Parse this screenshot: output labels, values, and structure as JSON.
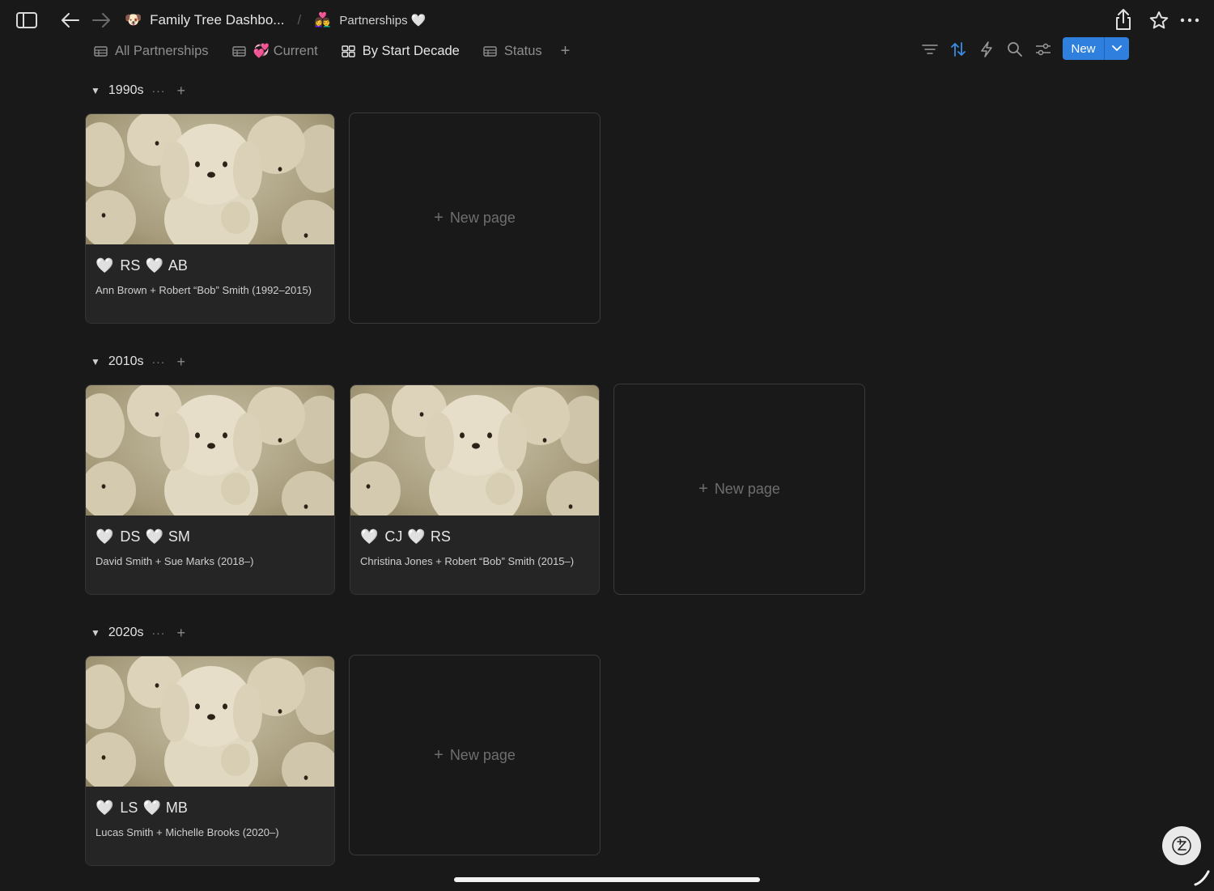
{
  "topbar": {
    "crumb1_emoji": "🐶",
    "crumb1_title": "Family Tree Dashbo...",
    "separator": "/",
    "crumb2_emoji": "👩‍❤️‍👨",
    "crumb2_title": "Partnerships 🤍"
  },
  "tabs": [
    {
      "label": "All Partnerships",
      "icon": "table-icon"
    },
    {
      "label": "💞 Current",
      "icon": "table-icon"
    },
    {
      "label": "By Start Decade",
      "icon": "gallery-icon",
      "active": true
    },
    {
      "label": "Status",
      "icon": "table-icon"
    }
  ],
  "tab_add": "+",
  "toolbar": {
    "new_label": "New",
    "accent": "#2f80de"
  },
  "groups": [
    {
      "name": "1990s",
      "cards": [
        {
          "a": "RS",
          "b": "AB",
          "desc": "Ann Brown + Robert “Bob” Smith (1992–2015)"
        }
      ],
      "new_page": "New page"
    },
    {
      "name": "2010s",
      "cards": [
        {
          "a": "DS",
          "b": "SM",
          "desc": "David Smith + Sue Marks (2018–)"
        },
        {
          "a": "CJ",
          "b": "RS",
          "desc": "Christina Jones + Robert “Bob” Smith (2015–)"
        }
      ],
      "new_page": "New page"
    },
    {
      "name": "2020s",
      "cards": [
        {
          "a": "LS",
          "b": "MB",
          "desc": "Lucas Smith + Michelle Brooks (2020–)"
        }
      ],
      "new_page": "New page"
    }
  ],
  "heart_left": "🤍",
  "heart_mid": "🤍",
  "group_dots": "···",
  "group_plus": "+"
}
